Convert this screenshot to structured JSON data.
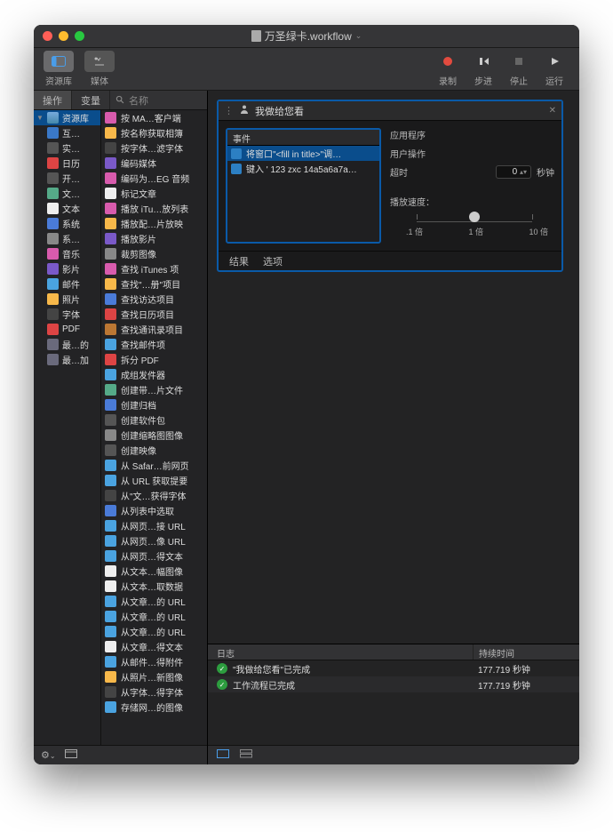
{
  "title": "万圣绿卡.workflow",
  "toolbar": {
    "left": [
      {
        "name": "library-toggle",
        "label": "资源库"
      },
      {
        "name": "media-toggle",
        "label": "媒体"
      }
    ],
    "right": [
      {
        "name": "record-button",
        "label": "录制",
        "color": "#e24b3f"
      },
      {
        "name": "step-button",
        "label": "步进",
        "color": "#ccc"
      },
      {
        "name": "stop-button",
        "label": "停止",
        "color": "#666"
      },
      {
        "name": "run-button",
        "label": "运行",
        "color": "#ccc"
      }
    ]
  },
  "tabs": {
    "actions": "操作",
    "variables": "变量",
    "search_ph": "名称"
  },
  "categories": [
    {
      "name": "资源库",
      "sel": true,
      "disc": "▼",
      "color": "linear-gradient(#7ad,#48a)"
    },
    {
      "name": "互…",
      "color": "#3a78c7"
    },
    {
      "name": "实…",
      "color": "#555"
    },
    {
      "name": "日历",
      "color": "#d44"
    },
    {
      "name": "开…",
      "color": "#555"
    },
    {
      "name": "文…",
      "color": "#5a8"
    },
    {
      "name": "文本",
      "color": "#eee"
    },
    {
      "name": "系统",
      "color": "#4a7bd8"
    },
    {
      "name": "系…",
      "color": "#888"
    },
    {
      "name": "音乐",
      "color": "#d85bad"
    },
    {
      "name": "影片",
      "color": "#7a59c8"
    },
    {
      "name": "邮件",
      "color": "#4aa3e0"
    },
    {
      "name": "照片",
      "color": "#f7b84a"
    },
    {
      "name": "字体",
      "color": "#444"
    },
    {
      "name": "PDF",
      "color": "#d44"
    },
    {
      "name": "最…的",
      "color": "#6a6a7c"
    },
    {
      "name": "最…加",
      "color": "#6a6a7c"
    }
  ],
  "actions": [
    "按 MA…客户端",
    "按名称获取相簿",
    "按字体…滤字体",
    "编码媒体",
    "编码为…EG 音频",
    "标记文章",
    "播放 iTu…放列表",
    "播放配…片放映",
    "播放影片",
    "裁剪图像",
    "查找 iTunes 项",
    "查找\"…册\"项目",
    "查找访达项目",
    "查找日历项目",
    "查找通讯录项目",
    "查找邮件项",
    "拆分 PDF",
    "成组发件器",
    "创建带…片文件",
    "创建归档",
    "创建软件包",
    "创建缩略图图像",
    "创建映像",
    "从 Safar…前网页",
    "从 URL 获取提要",
    "从\"文…获得字体",
    "从列表中选取",
    "从网页…接 URL",
    "从网页…像 URL",
    "从网页…得文本",
    "从文本…幅图像",
    "从文本…取数据",
    "从文章…的 URL",
    "从文章…的 URL",
    "从文章…的 URL",
    "从文章…得文本",
    "从邮件…得附件",
    "从照片…新图像",
    "从字体…得字体",
    "存储网…的图像"
  ],
  "action_icons": [
    "#d85bad",
    "#f7b84a",
    "#444",
    "#7a59c8",
    "#d85bad",
    "#eee",
    "#d85bad",
    "#f7b84a",
    "#7a59c8",
    "#888",
    "#d85bad",
    "#f7b84a",
    "#4a7bd8",
    "#d44",
    "#bb7733",
    "#4aa3e0",
    "#d44",
    "#4aa3e0",
    "#5a8",
    "#4a7bd8",
    "#555",
    "#888",
    "#555",
    "#4aa3e0",
    "#4aa3e0",
    "#444",
    "#4a7bd8",
    "#4aa3e0",
    "#4aa3e0",
    "#4aa3e0",
    "#eee",
    "#eee",
    "#4aa3e0",
    "#4aa3e0",
    "#4aa3e0",
    "#eee",
    "#4aa3e0",
    "#f7b84a",
    "#444",
    "#4aa3e0"
  ],
  "card": {
    "title": "我做给您看",
    "events_header": "事件",
    "events": [
      "将窗口\"<fill in title>\"调…",
      "键入 ' 123 zxc 14a5a6a7a…"
    ],
    "app_label": "应用程序",
    "user_label": "用户操作",
    "timeout_label": "超时",
    "timeout_value": "0",
    "timeout_unit": "秒钟",
    "speed_label": "播放速度：",
    "speed_marks": [
      ".1 倍",
      "1 倍",
      "10 倍"
    ],
    "footer": {
      "results": "结果",
      "options": "选项"
    }
  },
  "log": {
    "col1": "日志",
    "col2": "持续时间",
    "rows": [
      {
        "msg": "\"我做给您看\"已完成",
        "dur": "177.719 秒钟"
      },
      {
        "msg": "工作流程已完成",
        "dur": "177.719 秒钟"
      }
    ]
  },
  "gear_label": "⚙︎"
}
